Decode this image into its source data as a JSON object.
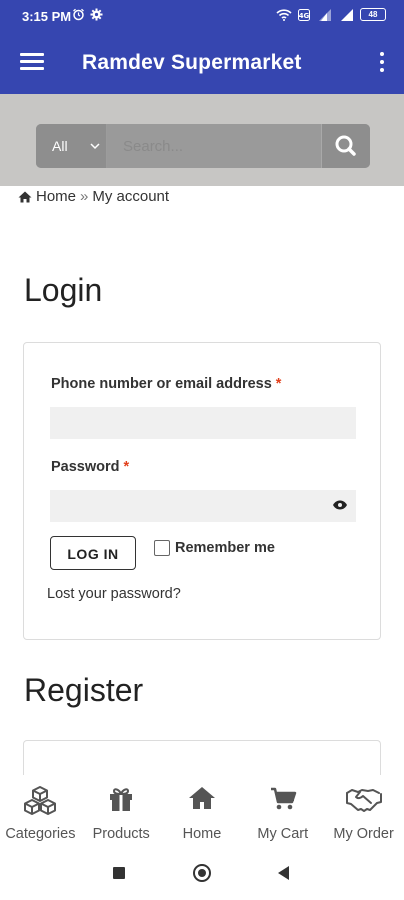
{
  "status_bar": {
    "time": "3:15 PM",
    "battery": "48"
  },
  "app_bar": {
    "title": "Ramdev Supermarket"
  },
  "search": {
    "category": "All",
    "placeholder": "Search..."
  },
  "breadcrumb": {
    "home": "Home",
    "separator": "»",
    "current": "My account"
  },
  "login": {
    "heading": "Login",
    "username_label": "Phone number or email address",
    "required_mark": "*",
    "password_label": "Password",
    "login_button": "LOG IN",
    "remember_label": "Remember me",
    "lost_password": "Lost your password?"
  },
  "register": {
    "heading": "Register"
  },
  "bottom_nav": {
    "items": [
      {
        "label": "Categories",
        "icon": "cubes-icon"
      },
      {
        "label": "Products",
        "icon": "gift-icon"
      },
      {
        "label": "Home",
        "icon": "home-icon"
      },
      {
        "label": "My Cart",
        "icon": "cart-icon"
      },
      {
        "label": "My Order",
        "icon": "handshake-icon"
      }
    ]
  },
  "colors": {
    "primary": "#3646b0",
    "required": "#e2401c",
    "search_bg": "#c7c6c4"
  }
}
